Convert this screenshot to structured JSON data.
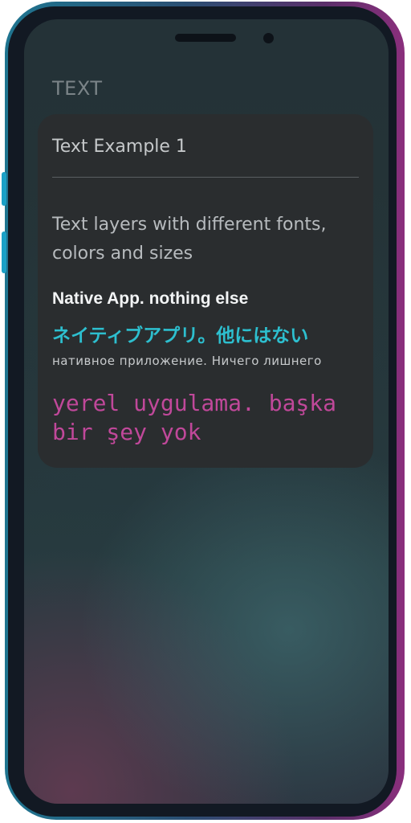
{
  "section": {
    "title": "TEXT"
  },
  "card": {
    "title": "Text Example 1",
    "description": "Text layers with different fonts, colors and sizes",
    "samples": {
      "english": "Native App. nothing else",
      "japanese": "ネイティブアプリ。他にはない",
      "russian": "нативное приложение. Ничего лишнего",
      "turkish": "yerel uygulama. başka bir şey yok"
    }
  },
  "colors": {
    "frame_left": "#1f7590",
    "frame_right": "#8a2f7c",
    "card_background": "#2a2d2f",
    "japanese_text": "#2dbfcf",
    "turkish_text": "#c0489a",
    "english_text": "#f2f4f5"
  }
}
